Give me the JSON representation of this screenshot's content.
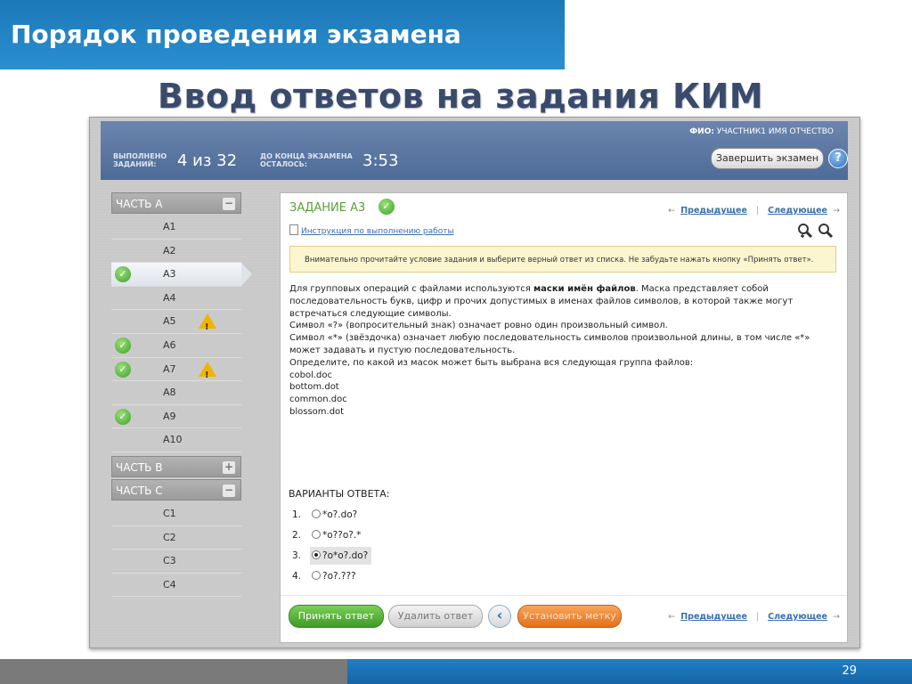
{
  "slide": {
    "header": "Порядок проведения экзамена",
    "subtitle": "Ввод ответов на задания КИМ",
    "page_number": "29"
  },
  "topbar": {
    "fio_label": "ФИО:",
    "fio_value": "УЧАСТНИК1 ИМЯ ОТЧЕСТВО",
    "done_label_1": "ВЫПОЛНЕНО",
    "done_label_2": "ЗАДАНИЙ:",
    "done_value": "4 из 32",
    "time_label_1": "ДО КОНЦА ЭКЗАМЕНА",
    "time_label_2": "ОСТАЛОСЬ:",
    "time_value": "3:53",
    "finish_button": "Завершить экзамен",
    "help_icon": "?"
  },
  "sidebar": {
    "part_a": {
      "label": "ЧАСТЬ А",
      "toggle": "−"
    },
    "items_a": [
      {
        "label": "A1",
        "check": false,
        "warn": false
      },
      {
        "label": "A2",
        "check": false,
        "warn": false
      },
      {
        "label": "A3",
        "check": true,
        "warn": false,
        "active": true
      },
      {
        "label": "A4",
        "check": false,
        "warn": false
      },
      {
        "label": "A5",
        "check": false,
        "warn": true
      },
      {
        "label": "A6",
        "check": true,
        "warn": false
      },
      {
        "label": "A7",
        "check": true,
        "warn": true
      },
      {
        "label": "A8",
        "check": false,
        "warn": false
      },
      {
        "label": "A9",
        "check": true,
        "warn": false
      },
      {
        "label": "A10",
        "check": false,
        "warn": false
      }
    ],
    "part_b": {
      "label": "ЧАСТЬ В",
      "toggle": "+"
    },
    "part_c": {
      "label": "ЧАСТЬ С",
      "toggle": "−"
    },
    "items_c": [
      {
        "label": "C1"
      },
      {
        "label": "C2"
      },
      {
        "label": "C3"
      },
      {
        "label": "C4"
      }
    ]
  },
  "task": {
    "title": "ЗАДАНИЕ А3",
    "prev": "Предыдущее",
    "next": "Следующее",
    "instruction_link": "Инструкция по выполнению работы",
    "notice": "Внимательно прочитайте условие задания и выберите верный ответ из списка. Не забудьте нажать кнопку «Принять ответ».",
    "question_pre": "Для групповых операций с файлами используются ",
    "question_bold": "маски имён файлов",
    "question_post": ". Маска представляет собой последовательность букв, цифр и прочих допустимых в именах файлов символов, в которой также могут встречаться следующие символы.",
    "question_lines": [
      "Символ «?» (вопросительный знак) означает ровно один произвольный символ.",
      "Символ «*» (звёздочка) означает любую последовательность символов произвольной длины, в том числе «*» может задавать и пустую последовательность.",
      "Определите, по какой из масок может быть  выбрана вся следующая группа файлов:",
      "cobol.doc",
      "bottom.dot",
      "common.doc",
      "blossom.dot"
    ],
    "answers_title": "ВАРИАНТЫ ОТВЕТА:",
    "answers": [
      {
        "num": "1.",
        "text": "*o?.do?",
        "selected": false
      },
      {
        "num": "2.",
        "text": "*o??o?.*",
        "selected": false
      },
      {
        "num": "3.",
        "text": "?o*o?.do?",
        "selected": true
      },
      {
        "num": "4.",
        "text": "?o?.???",
        "selected": false
      }
    ]
  },
  "bottom": {
    "accept": "Принять ответ",
    "delete": "Удалить ответ",
    "back_icon": "‹",
    "mark": "Установить метку",
    "prev": "Предыдущее",
    "next": "Следующее"
  }
}
